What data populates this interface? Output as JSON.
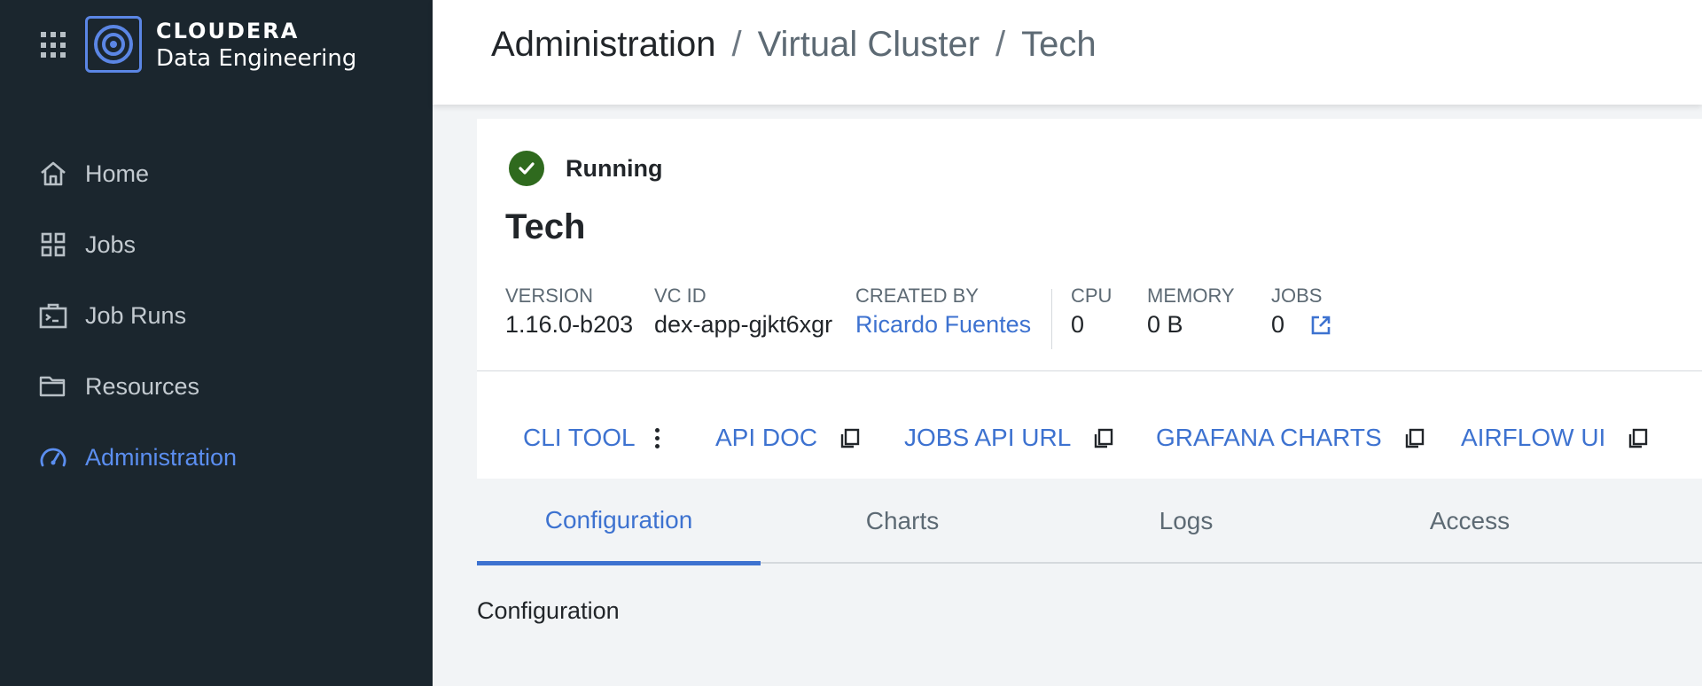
{
  "brand": {
    "company": "CLOUDERA",
    "product": "Data Engineering"
  },
  "sidebar": {
    "items": [
      {
        "label": "Home",
        "icon": "home-icon"
      },
      {
        "label": "Jobs",
        "icon": "grid-icon"
      },
      {
        "label": "Job Runs",
        "icon": "job-runs-icon"
      },
      {
        "label": "Resources",
        "icon": "folder-icon"
      },
      {
        "label": "Administration",
        "icon": "gauge-icon",
        "active": true
      }
    ]
  },
  "header": {
    "breadcrumb": [
      "Administration",
      "Virtual Cluster",
      "Tech"
    ],
    "separator": "/"
  },
  "cluster": {
    "status": "Running",
    "name": "Tech",
    "meta": {
      "version_label": "VERSION",
      "version_value": "1.16.0-b203",
      "vcid_label": "VC ID",
      "vcid_value": "dex-app-gjkt6xgr",
      "created_label": "CREATED BY",
      "created_value": "Ricardo Fuentes",
      "cpu_label": "CPU",
      "cpu_value": "0",
      "memory_label": "MEMORY",
      "memory_value": "0 B",
      "jobs_label": "JOBS",
      "jobs_value": "0"
    },
    "links": {
      "cli_tool": "CLI TOOL",
      "api_doc": "API DOC",
      "jobs_api_url": "JOBS API URL",
      "grafana_charts": "GRAFANA CHARTS",
      "airflow_ui": "AIRFLOW UI"
    }
  },
  "tabs": [
    {
      "label": "Configuration",
      "active": true
    },
    {
      "label": "Charts"
    },
    {
      "label": "Logs"
    },
    {
      "label": "Access"
    }
  ],
  "section": {
    "title": "Configuration"
  },
  "colors": {
    "sidebar_bg": "#1b262e",
    "accent": "#3d72d0",
    "active_nav": "#5b8ef0",
    "status_ok": "#2f6a1e"
  }
}
